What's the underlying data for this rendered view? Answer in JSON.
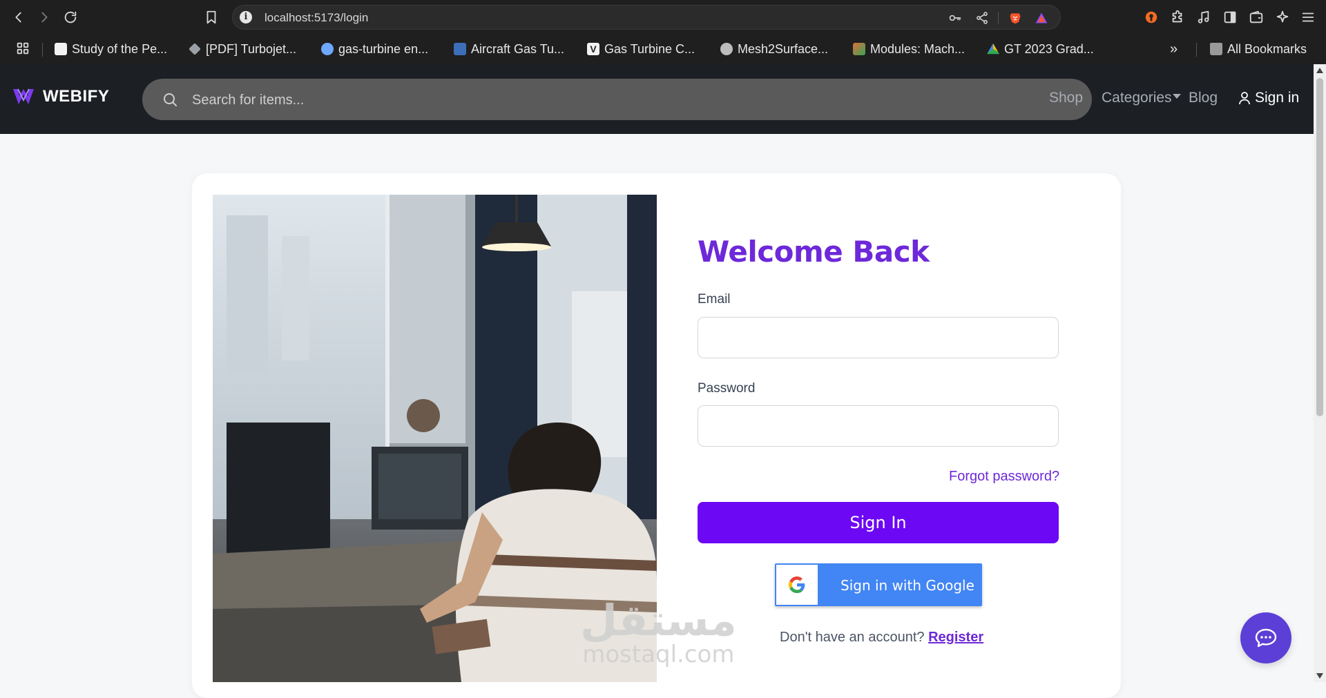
{
  "browser": {
    "url": "localhost:5173/login",
    "bookmarks": [
      {
        "label": "Study of the Pe...",
        "color": "#f2f2f2"
      },
      {
        "label": "[PDF] Turbojet...",
        "color": "#9aa0a6"
      },
      {
        "label": "gas-turbine en...",
        "color": "#6ea8ff"
      },
      {
        "label": "Aircraft Gas Tu...",
        "color": "#6ea8ff"
      },
      {
        "label": "Gas Turbine C...",
        "color": "#f2f2f2"
      },
      {
        "label": "Mesh2Surface...",
        "color": "#bdbdbd"
      },
      {
        "label": "Modules: Mach...",
        "color": "#e06c3c"
      },
      {
        "label": "GT 2023 Grad...",
        "color": "#34a853"
      }
    ],
    "all_bookmarks_label": "All Bookmarks",
    "overflow_label": "»"
  },
  "header": {
    "brand": "WEBIFY",
    "search_placeholder": "Search for items...",
    "nav": {
      "shop": "Shop",
      "categories": "Categories",
      "blog": "Blog",
      "signin": "Sign in"
    }
  },
  "login": {
    "title": "Welcome Back",
    "email_label": "Email",
    "email_value": "",
    "password_label": "Password",
    "password_value": "",
    "forgot": "Forgot password?",
    "signin_button": "Sign In",
    "google_button": "Sign in with Google",
    "no_account": "Don't have an account?",
    "register": "Register"
  },
  "watermark": {
    "arabic": "مستقل",
    "latin": "mostaql.com"
  },
  "colors": {
    "accent": "#6d28d9",
    "button": "#6d08f5",
    "google_blue": "#4285f4",
    "chat_fab": "#5b3fd6"
  }
}
